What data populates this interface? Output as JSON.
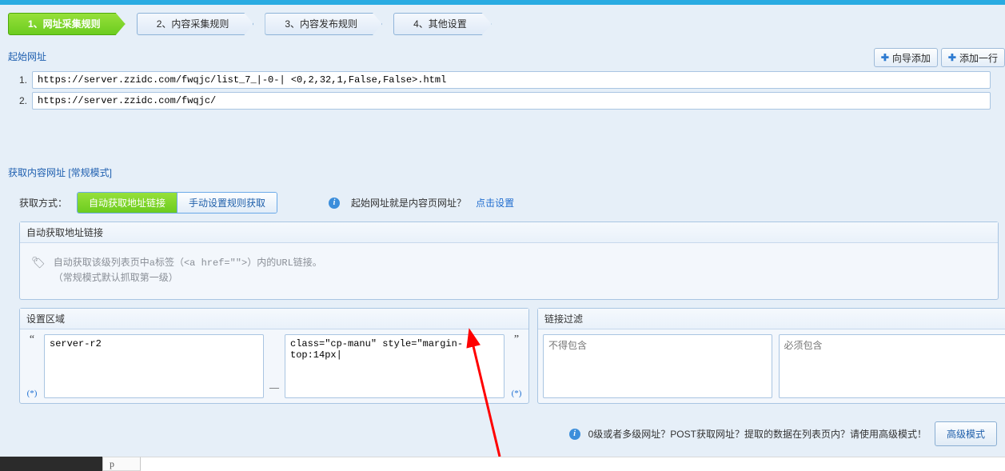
{
  "tabs": {
    "t1": "1、网址采集规则",
    "t2": "2、内容采集规则",
    "t3": "3、内容发布规则",
    "t4": "4、其他设置"
  },
  "start_urls": {
    "title": "起始网址",
    "btn_wizard": "向导添加",
    "btn_addrow": "添加一行",
    "rows": {
      "idx1": "1.",
      "url1": "https://server.zzidc.com/fwqjc/list_7_|-0-| <0,2,32,1,False,False>.html",
      "idx2": "2.",
      "url2": "https://server.zzidc.com/fwqjc/"
    }
  },
  "fetch": {
    "title": "获取内容网址 [常规模式]",
    "mode_label": "获取方式：",
    "mode_auto": "自动获取地址链接",
    "mode_manual": "手动设置规则获取",
    "hint_q": "起始网址就是内容页网址？",
    "hint_link": "点击设置"
  },
  "auto": {
    "header": "自动获取地址链接",
    "hint": "自动获取该级列表页中a标签（<a href=\"\">）内的URL链接。\n（常规模式默认抓取第一级）"
  },
  "region": {
    "header": "设置区域",
    "start_val": "server-r2",
    "end_val": "class=\"cp-manu\" style=\"margin-top:14px|",
    "wildcard": "(*)"
  },
  "filter": {
    "header": "链接过滤",
    "exclude_ph": "不得包含",
    "include_ph": "必须包含"
  },
  "bottom": {
    "info": "0级或者多级网址？POST获取网址？提取的数据在列表页内？请使用高级模式！",
    "btn": "高级模式"
  },
  "footer": {
    "p": "p"
  }
}
